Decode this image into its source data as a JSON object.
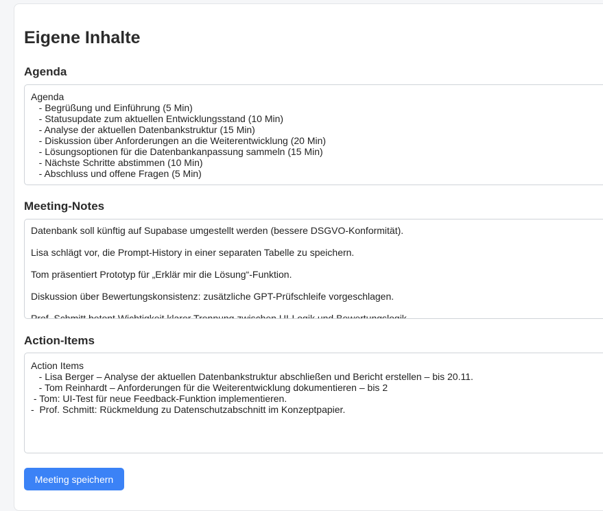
{
  "page": {
    "title": "Eigene Inhalte"
  },
  "agenda": {
    "label": "Agenda",
    "content": "Agenda\n   - Begrüßung und Einführung (5 Min)\n   - Statusupdate zum aktuellen Entwicklungsstand (10 Min)\n   - Analyse der aktuellen Datenbankstruktur (15 Min)\n   - Diskussion über Anforderungen an die Weiterentwicklung (20 Min)\n   - Lösungsoptionen für die Datenbankanpassung sammeln (15 Min)\n   - Nächste Schritte abstimmen (10 Min)\n   - Abschluss und offene Fragen (5 Min)"
  },
  "notes": {
    "label": "Meeting-Notes",
    "paragraphs": [
      "Datenbank soll künftig auf Supabase umgestellt werden (bessere DSGVO-Konformität).",
      "Lisa schlägt vor, die Prompt-History in einer separaten Tabelle zu speichern.",
      "Tom präsentiert Prototyp für „Erklär mir die Lösung“-Funktion.",
      "Diskussion über Bewertungskonsistenz: zusätzliche GPT-Prüfschleife vorgeschlagen.",
      "Prof. Schmitt betont Wichtigkeit klarer Trennung zwischen UI-Logik und Bewertungslogik."
    ]
  },
  "action_items": {
    "label": "Action-Items",
    "content": "Action Items\n   - Lisa Berger – Analyse der aktuellen Datenbankstruktur abschließen und Bericht erstellen – bis 20.11.\n   - Tom Reinhardt – Anforderungen für die Weiterentwicklung dokumentieren – bis 2\n - Tom: UI-Test für neue Feedback-Funktion implementieren.\n-  Prof. Schmitt: Rückmeldung zu Datenschutzabschnitt im Konzeptpapier."
  },
  "actions": {
    "save_label": "Meeting speichern"
  },
  "colors": {
    "accent": "#3b82f6",
    "border": "#cfd3d8"
  }
}
